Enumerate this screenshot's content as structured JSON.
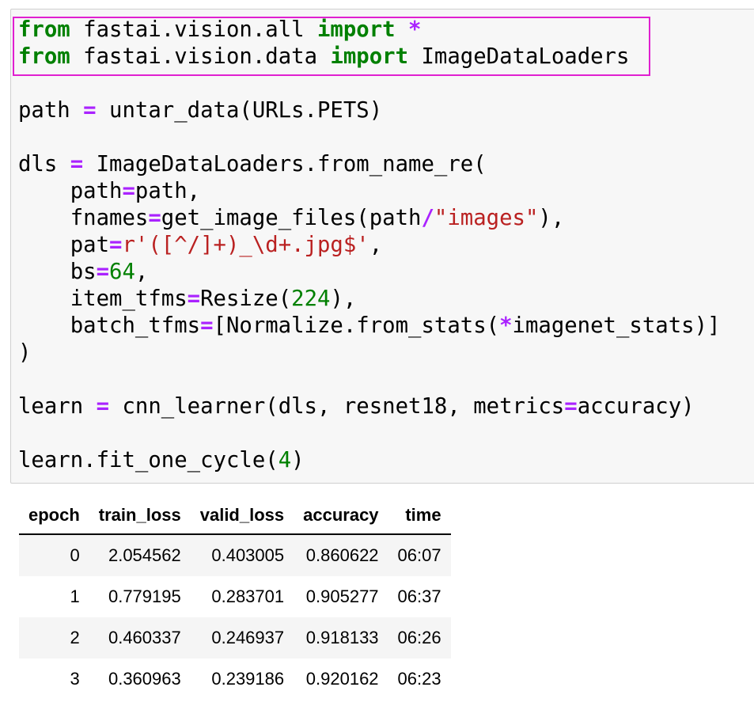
{
  "code_cell": {
    "lines": [
      [
        {
          "t": "from",
          "c": "kw"
        },
        {
          "t": " fastai.vision.all ",
          "c": ""
        },
        {
          "t": "import",
          "c": "kw"
        },
        {
          "t": " ",
          "c": ""
        },
        {
          "t": "*",
          "c": "op"
        }
      ],
      [
        {
          "t": "from",
          "c": "kw"
        },
        {
          "t": " fastai.vision.data ",
          "c": ""
        },
        {
          "t": "import",
          "c": "kw"
        },
        {
          "t": " ImageDataLoaders",
          "c": ""
        }
      ],
      [],
      [
        {
          "t": "path ",
          "c": ""
        },
        {
          "t": "=",
          "c": "op"
        },
        {
          "t": " untar_data(URLs.PETS)",
          "c": ""
        }
      ],
      [],
      [
        {
          "t": "dls ",
          "c": ""
        },
        {
          "t": "=",
          "c": "op"
        },
        {
          "t": " ImageDataLoaders.from_name_re(",
          "c": ""
        }
      ],
      [
        {
          "t": "    path",
          "c": ""
        },
        {
          "t": "=",
          "c": "op"
        },
        {
          "t": "path,",
          "c": ""
        }
      ],
      [
        {
          "t": "    fnames",
          "c": ""
        },
        {
          "t": "=",
          "c": "op"
        },
        {
          "t": "get_image_files(path",
          "c": ""
        },
        {
          "t": "/",
          "c": "op"
        },
        {
          "t": "\"images\"",
          "c": "str"
        },
        {
          "t": "),",
          "c": ""
        }
      ],
      [
        {
          "t": "    pat",
          "c": ""
        },
        {
          "t": "=",
          "c": "op"
        },
        {
          "t": "r'([^/]+)_\\d+.jpg$'",
          "c": "str"
        },
        {
          "t": ",",
          "c": ""
        }
      ],
      [
        {
          "t": "    bs",
          "c": ""
        },
        {
          "t": "=",
          "c": "op"
        },
        {
          "t": "64",
          "c": "num"
        },
        {
          "t": ",",
          "c": ""
        }
      ],
      [
        {
          "t": "    item_tfms",
          "c": ""
        },
        {
          "t": "=",
          "c": "op"
        },
        {
          "t": "Resize(",
          "c": ""
        },
        {
          "t": "224",
          "c": "num"
        },
        {
          "t": "),",
          "c": ""
        }
      ],
      [
        {
          "t": "    batch_tfms",
          "c": ""
        },
        {
          "t": "=",
          "c": "op"
        },
        {
          "t": "[Normalize.from_stats(",
          "c": ""
        },
        {
          "t": "*",
          "c": "op"
        },
        {
          "t": "imagenet_stats)]",
          "c": ""
        }
      ],
      [
        {
          "t": ")",
          "c": ""
        }
      ],
      [],
      [
        {
          "t": "learn ",
          "c": ""
        },
        {
          "t": "=",
          "c": "op"
        },
        {
          "t": " cnn_learner(dls, resnet18, metrics",
          "c": ""
        },
        {
          "t": "=",
          "c": "op"
        },
        {
          "t": "accuracy)",
          "c": ""
        }
      ],
      [],
      [
        {
          "t": "learn.fit_one_cycle(",
          "c": ""
        },
        {
          "t": "4",
          "c": "num"
        },
        {
          "t": ")",
          "c": ""
        }
      ]
    ]
  },
  "colors": {
    "keyword": "#008000",
    "operator": "#aa22ff",
    "string": "#ba2121",
    "number": "#008000",
    "highlight_box": "#e020d0",
    "cell_background": "#f7f7f7"
  },
  "results_table": {
    "headers": [
      "epoch",
      "train_loss",
      "valid_loss",
      "accuracy",
      "time"
    ],
    "rows": [
      [
        "0",
        "2.054562",
        "0.403005",
        "0.860622",
        "06:07"
      ],
      [
        "1",
        "0.779195",
        "0.283701",
        "0.905277",
        "06:37"
      ],
      [
        "2",
        "0.460337",
        "0.246937",
        "0.918133",
        "06:26"
      ],
      [
        "3",
        "0.360963",
        "0.239186",
        "0.920162",
        "06:23"
      ]
    ]
  }
}
